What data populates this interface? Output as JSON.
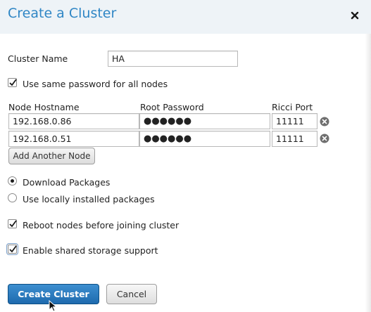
{
  "dialog": {
    "title": "Create a Cluster",
    "close_glyph": "×"
  },
  "form": {
    "cluster_name_label": "Cluster Name",
    "cluster_name_value": "HA",
    "same_password_label": "Use same password for all nodes",
    "same_password_checked": true,
    "nodes_table": {
      "columns": [
        "Node Hostname",
        "Root Password",
        "Ricci Port"
      ],
      "rows": [
        {
          "hostname": "192.168.0.86",
          "password_mask": "●●●●●●",
          "port": "11111"
        },
        {
          "hostname": "192.168.0.51",
          "password_mask": "●●●●●●",
          "port": "11111"
        }
      ],
      "remove_icon": "remove-circle-icon"
    },
    "add_node_label": "Add Another Node",
    "package_options": [
      {
        "label": "Download Packages",
        "selected": true
      },
      {
        "label": "Use locally installed packages",
        "selected": false
      }
    ],
    "reboot_label": "Reboot nodes before joining cluster",
    "reboot_checked": true,
    "shared_storage_label": "Enable shared storage support",
    "shared_storage_checked": true
  },
  "actions": {
    "create_label": "Create Cluster",
    "cancel_label": "Cancel"
  },
  "colors": {
    "title": "#2f86c5",
    "header_bg": "#eef3f7",
    "primary_button": "#2a78bd"
  }
}
